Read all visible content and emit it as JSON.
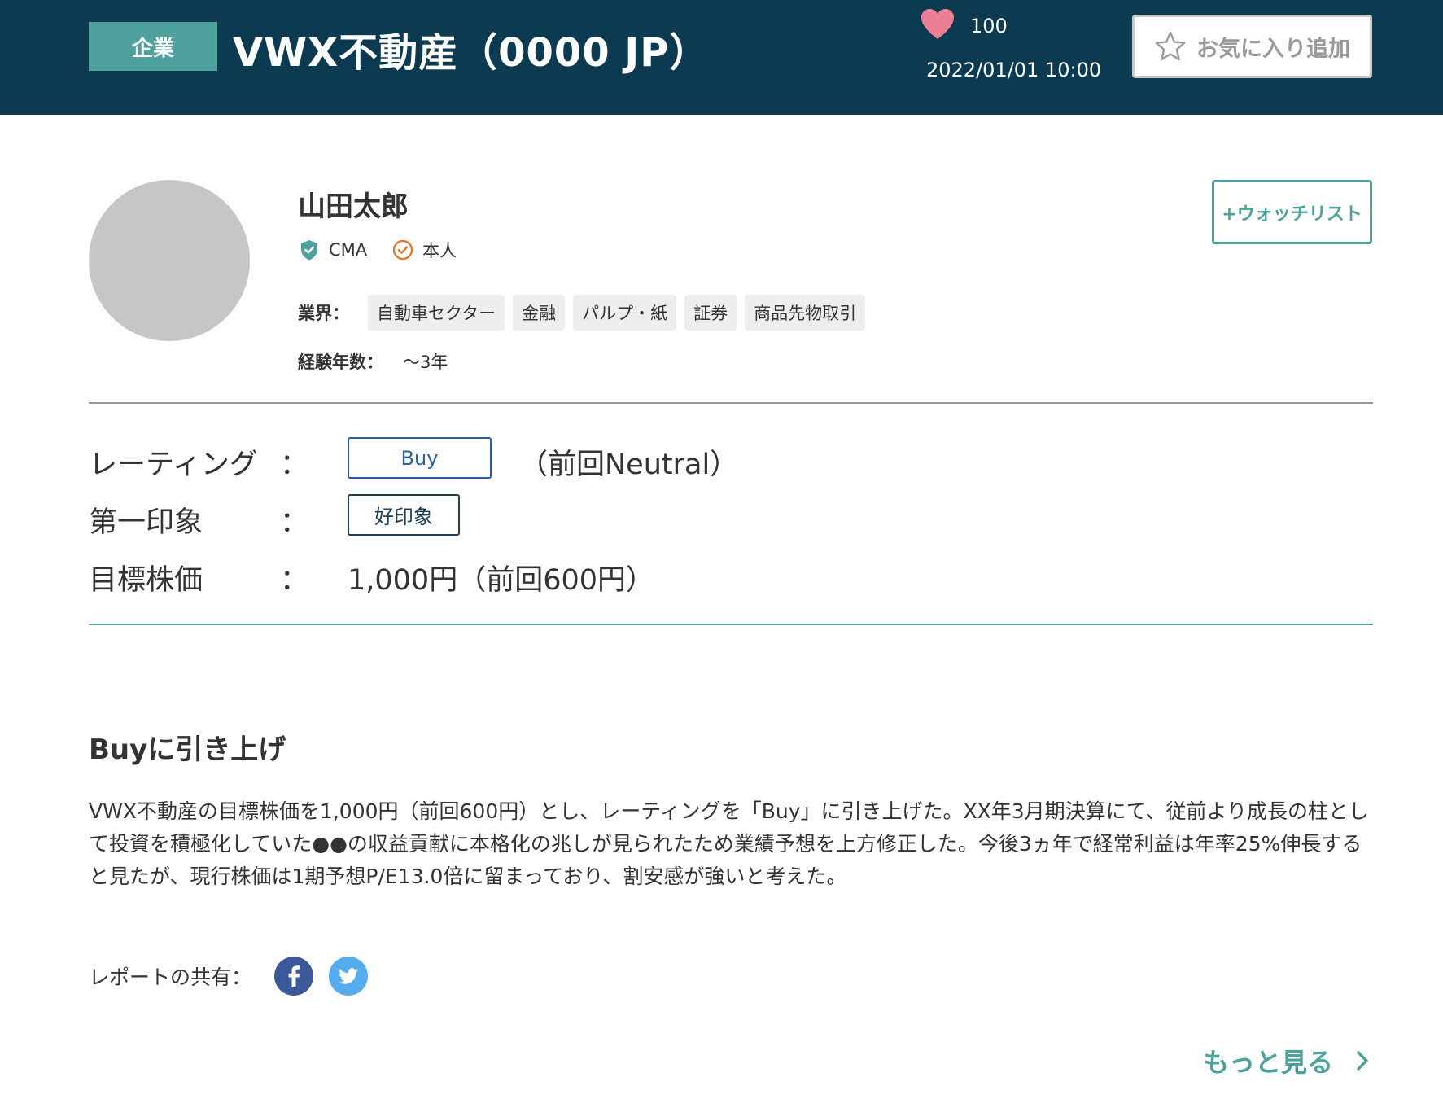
{
  "header": {
    "category_badge": "企業",
    "title": "VWX不動産（0000 JP）",
    "like_count": "100",
    "date": "2022/01/01 10:00",
    "favorite_label": "お気に入り追加"
  },
  "analyst": {
    "name": "山田太郎",
    "cert_label": "CMA",
    "verified_label": "本人",
    "industry_label": "業界：",
    "industries": [
      "自動車セクター",
      "金融",
      "パルプ・紙",
      "証券",
      "商品先物取引"
    ],
    "experience_label": "経験年数：",
    "experience_value": "〜3年",
    "watch_label": "+ウォッチリスト"
  },
  "rating": {
    "rating_label": "レーティング",
    "colon": "：",
    "rating_value": "Buy",
    "rating_prev": "（前回Neutral）",
    "impression_label": "第一印象",
    "impression_value": "好印象",
    "target_label": "目標株価",
    "target_value": "1,000円（前回600円）"
  },
  "report": {
    "heading": "Buyに引き上げ",
    "body": "VWX不動産の目標株価を1,000円（前回600円）とし、レーティングを「Buy」に引き上げた。XX年3月期決算にて、従前より成長の柱として投資を積極化していた●●の収益貢献に本格化の兆しが見られたため業績予想を上方修正した。今後3ヵ年で経常利益は年率25%伸長すると見たが、現行株価は1期予想P/E13.0倍に留まっており、割安感が強いと考えた。",
    "share_label": "レポートの共有：",
    "more_label": "もっと見る"
  },
  "icons": {
    "heart": "heart-icon",
    "star": "star-outline-icon",
    "shield": "shield-check-icon",
    "check": "check-circle-icon",
    "facebook": "facebook-icon",
    "twitter": "twitter-icon",
    "chevron": "chevron-right-icon"
  },
  "colors": {
    "header_bg": "#0c3a50",
    "accent_teal": "#4ea19c",
    "rating_blue": "#2a5ea8",
    "heart_pink": "#ec7f93",
    "check_orange": "#e07a2e",
    "facebook_blue": "#3b5998",
    "twitter_blue": "#55acee"
  }
}
